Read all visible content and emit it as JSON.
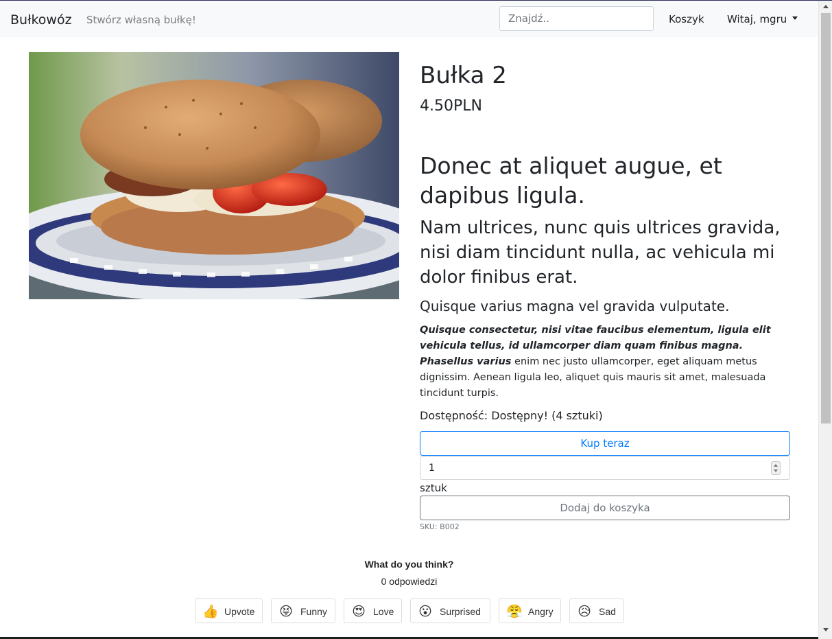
{
  "navbar": {
    "brand": "Bułkowóz",
    "tagline": "Stwórz własną bułkę!",
    "search_placeholder": "Znajdź..",
    "cart_label": "Koszyk",
    "user_label": "Witaj, mgru"
  },
  "product": {
    "title": "Bułka 2",
    "price": "4.50PLN",
    "heading1": "Donec at aliquet augue, et dapibus ligula.",
    "heading2": "Nam ultrices, nunc quis ultrices gravida, nisi diam tincidunt nulla, ac vehicula mi dolor finibus erat.",
    "heading3": "Quisque varius magna vel gravida vulputate.",
    "description_bold": "Quisque consectetur, nisi vitae faucibus elementum, ligula elit vehicula tellus, id ullamcorper diam quam finibus magna. Phasellus varius",
    "description_rest": " enim nec justo ullamcorper, eget aliquam metus dignissim. Aenean ligula leo, aliquet quis mauris sit amet, malesuada tincidunt turpis.",
    "availability": "Dostępność: Dostępny! (4 sztuki)",
    "buy_now_label": "Kup teraz",
    "quantity_value": "1",
    "units_label": "sztuk",
    "add_to_cart_label": "Dodaj do koszyka",
    "sku": "SKU: B002"
  },
  "reactions": {
    "question": "What do you think?",
    "responses": "0 odpowiedzi",
    "items": [
      {
        "label": "Upvote",
        "emoji": "👍",
        "icon": "thumbs-up-icon"
      },
      {
        "label": "Funny",
        "emoji": "😝",
        "icon": "funny-face-icon"
      },
      {
        "label": "Love",
        "emoji": "😍",
        "icon": "heart-eyes-icon"
      },
      {
        "label": "Surprised",
        "emoji": "😮",
        "icon": "surprised-face-icon"
      },
      {
        "label": "Angry",
        "emoji": "😤",
        "icon": "angry-face-icon"
      },
      {
        "label": "Sad",
        "emoji": "😥",
        "icon": "sad-face-icon"
      }
    ]
  }
}
